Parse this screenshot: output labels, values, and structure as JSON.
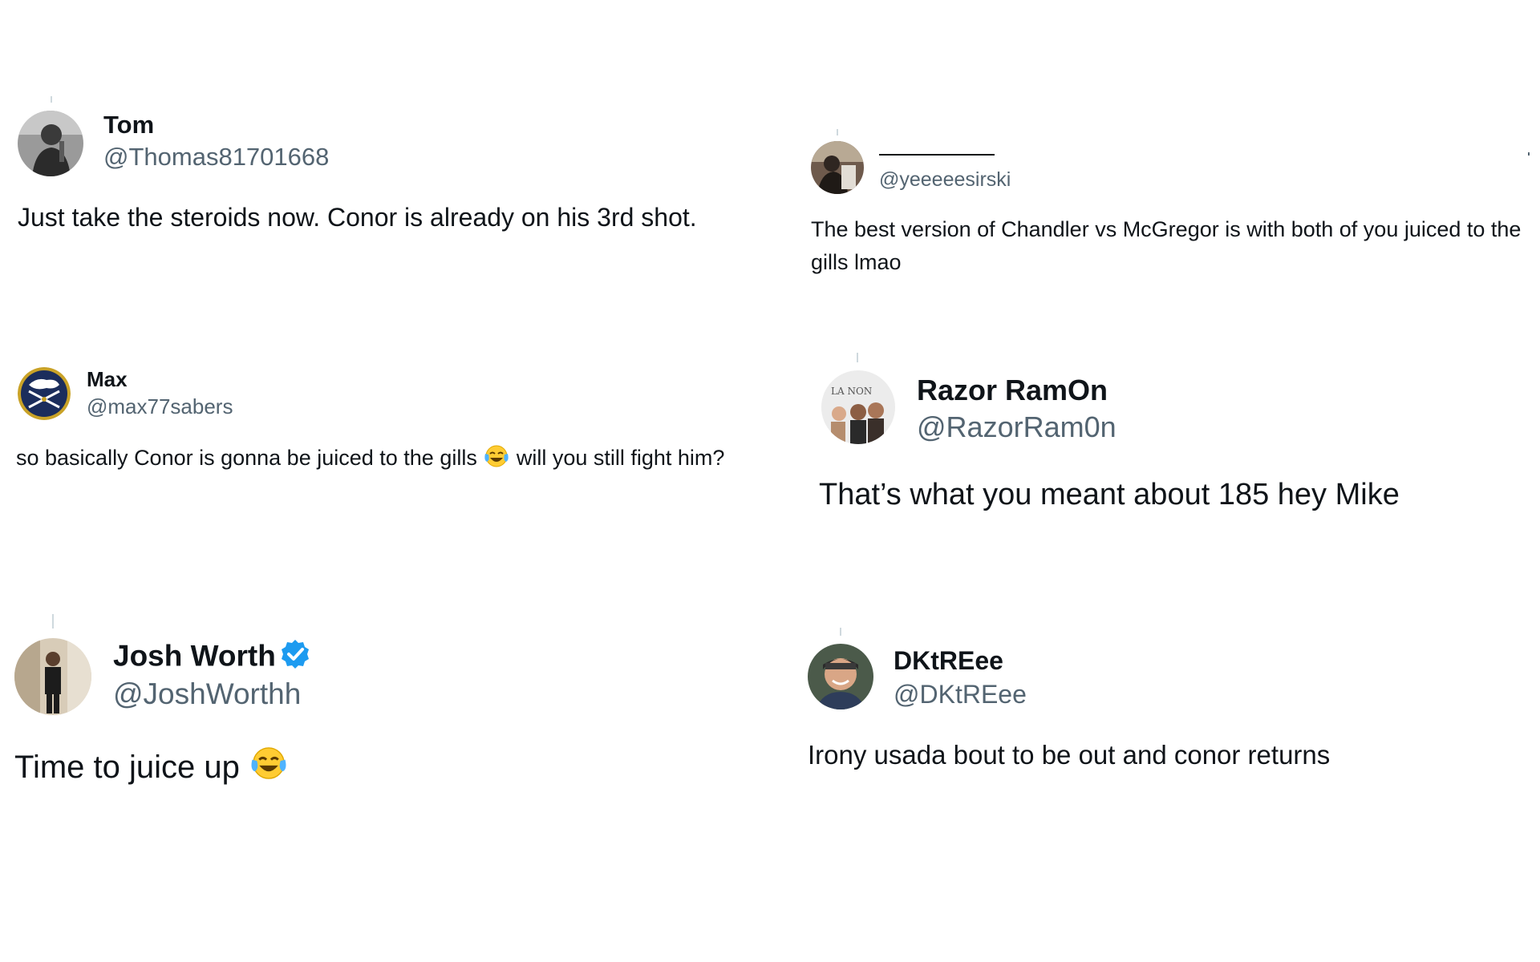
{
  "tweets": [
    {
      "name": "Tom",
      "handle": "@Thomas81701668",
      "text": "Just take the steroids now. Conor is already on his 3rd shot."
    },
    {
      "name": "",
      "handle": "@yeeeeesirski",
      "text": "The best version of Chandler vs McGregor is with both of you juiced to the gills lmao"
    },
    {
      "name": "Max",
      "handle": "@max77sabers",
      "text_before": "so basically Conor is gonna be juiced to the gills ",
      "text_after": " will you still fight him?",
      "emoji": "face-with-tears-of-joy"
    },
    {
      "name": "Razor RamOn",
      "handle": "@RazorRam0n",
      "text": "That’s what you meant about 185 hey Mike"
    },
    {
      "name": "Josh Worth",
      "handle": "@JoshWorthh",
      "text_before": "Time to juice up ",
      "emoji": "face-with-tears-of-joy",
      "verified": true
    },
    {
      "name": "DKtREee",
      "handle": "@DKtREee",
      "text": "Irony usada bout to be out and conor returns"
    }
  ],
  "colors": {
    "text": "#0f1419",
    "secondary": "#536471",
    "verified": "#1d9bf0",
    "connector": "#cfd9de"
  }
}
